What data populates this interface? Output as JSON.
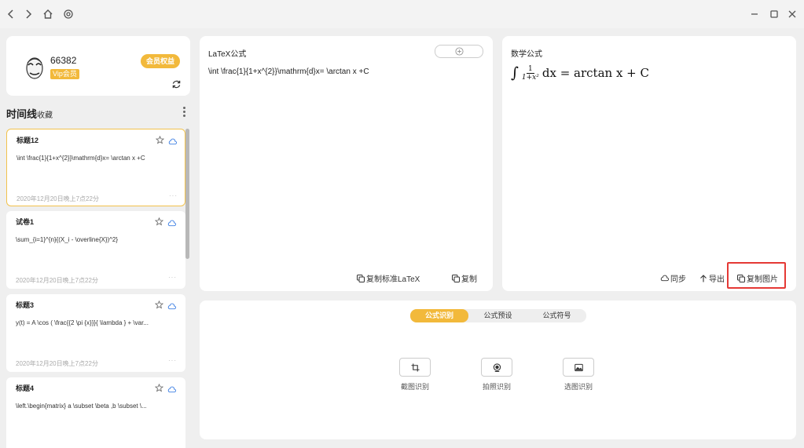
{
  "profile": {
    "username": "66382",
    "vip_label": "Vip会员",
    "member_button": "会员权益"
  },
  "timeline": {
    "title": "时间线",
    "favorites": "收藏",
    "items": [
      {
        "title": "标题12",
        "body": "\\int \\frac{1}{1+x^{2}}\\mathrm{d}x= \\arctan x +C",
        "date": "2020年12月20日晚上7点22分",
        "more": "···"
      },
      {
        "title": "试卷1",
        "body": "\\sum_{i=1}^{n}{(X_i - \\overline{X})^2}",
        "date": "2020年12月20日晚上7点22分",
        "more": "···"
      },
      {
        "title": "标题3",
        "body": "y(t) = A \\cos ( \\frac{{2 \\pi {x}}}{ \\lambda } + \\var...",
        "date": "2020年12月20日晚上7点22分",
        "more": "···"
      },
      {
        "title": "标题4",
        "body": "\\left.\\begin{matrix} a \\subset \\beta ,b \\subset \\...",
        "date": "",
        "more": ""
      }
    ]
  },
  "latex_panel": {
    "title": "LaTeX公式",
    "source": "\\int \\frac{1}{1+x^{2}}\\mathrm{d}x= \\arctan x +C",
    "copy_standard": "复制标准LaTeX",
    "copy": "复制"
  },
  "math_panel": {
    "title": "数学公式",
    "formula": {
      "integral": "∫",
      "numerator": "1",
      "denominator": "1+x²",
      "rest": "dx = arctan x + C"
    },
    "sync": "同步",
    "export": "导出",
    "copy_image": "复制图片"
  },
  "recognition": {
    "tabs": [
      "公式识别",
      "公式预设",
      "公式符号"
    ],
    "active_tab": 0,
    "tools": [
      {
        "label": "截图识别",
        "icon": "crop-icon"
      },
      {
        "label": "拍照识别",
        "icon": "camera-icon"
      },
      {
        "label": "选图识别",
        "icon": "image-icon"
      }
    ]
  },
  "colors": {
    "accent": "#f2b93b",
    "highlight": "#e53935",
    "cloud": "#3b7ee3"
  }
}
